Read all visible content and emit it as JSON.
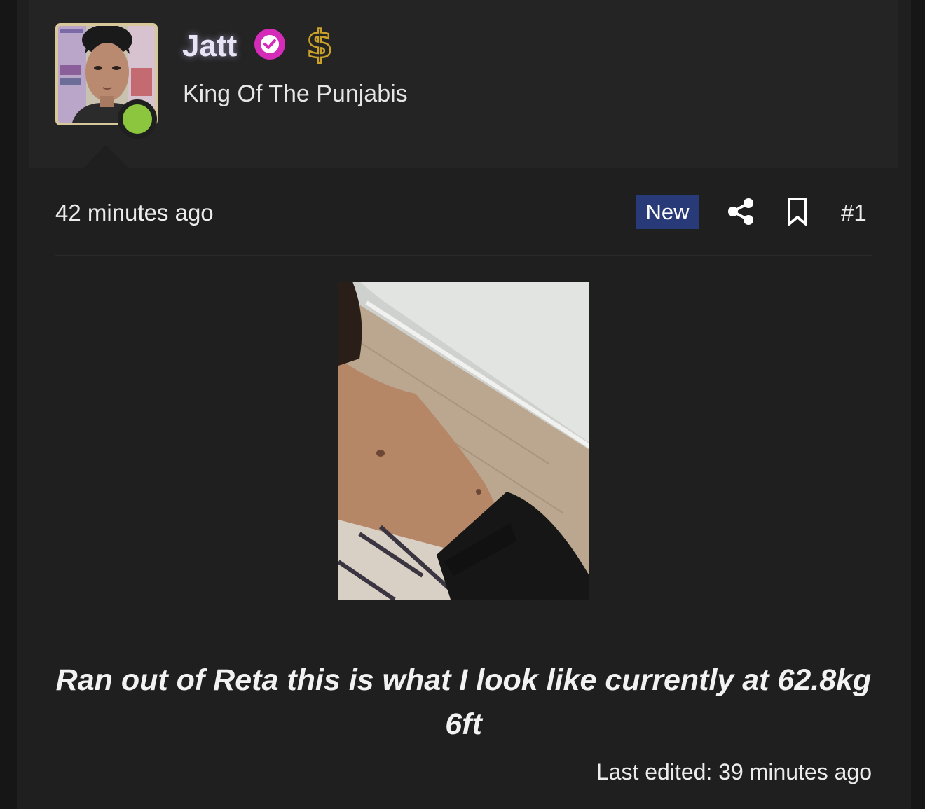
{
  "user": {
    "name": "Jatt",
    "title": "King Of The Punjabis",
    "avatar_icon": "user-avatar-photo",
    "verified_icon": "verified-check-icon",
    "badge_icon": "dollar-sign-icon",
    "online_status_icon": "online-dot-icon"
  },
  "post": {
    "timestamp": "42 minutes ago",
    "new_label": "New",
    "post_number": "#1",
    "share_icon": "share-icon",
    "bookmark_icon": "bookmark-icon",
    "image_icon": "attached-photo",
    "text": "Ran out of Reta this is what I look like currently at 62.8kg 6ft",
    "last_edited": "Last edited: 39 minutes ago"
  },
  "colors": {
    "background": "#1f1f1f",
    "user_block": "#242424",
    "new_badge": "#283a77",
    "verified": "#d42bb8",
    "online": "#8cc63f",
    "dollar": "#c9a227"
  }
}
